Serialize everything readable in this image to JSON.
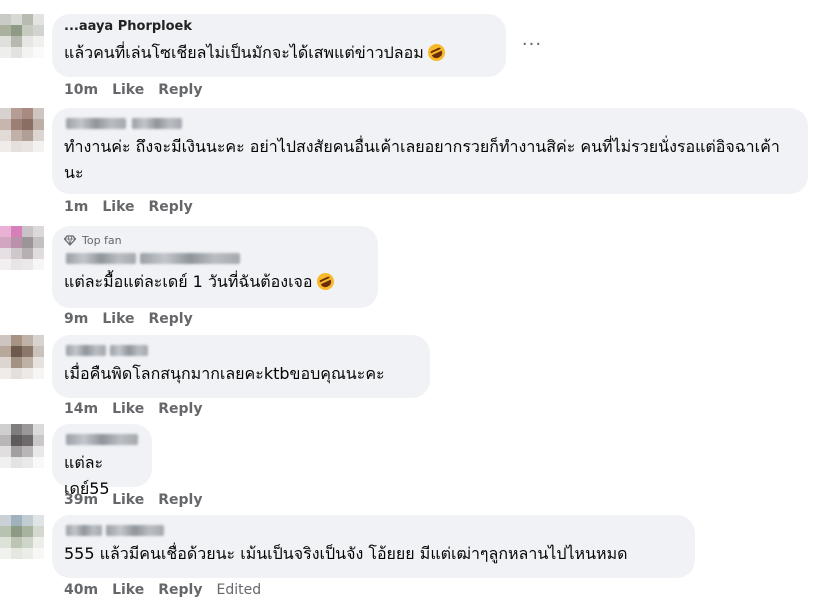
{
  "comments": [
    {
      "name": "...aaya Phorploek",
      "text": "แล้วคนที่เล่นโซเชียลไม่เป็นมักจะได้เสพแต่ข่าวปลอม",
      "emoji": "rolling-on-floor-laughing",
      "time": "10m",
      "like": "Like",
      "reply": "Reply"
    },
    {
      "name": "",
      "text": "ทำงานค่ะ ถึงจะมีเงินนะคะ อย่าไปสงสัยคนอื่นเค้าเลยอยากรวยก็ทำงานสิค่ะ คนที่ไม่รวยนั่งรอแต่อิจฉาเค้านะ",
      "time": "1m",
      "like": "Like",
      "reply": "Reply"
    },
    {
      "badge": "Top fan",
      "name": "",
      "text": "แต่ละมื้อแต่ละเดย์ 1 วันที่ฉันต้องเจอ",
      "emoji": "rolling-on-floor-laughing",
      "time": "9m",
      "like": "Like",
      "reply": "Reply"
    },
    {
      "name": "",
      "text": "เมื่อคืนพิดโลกสนุกมากเลยคะktbขอบคุณนะคะ",
      "time": "14m",
      "like": "Like",
      "reply": "Reply"
    },
    {
      "name": "",
      "text": "แต่ละเดย์55",
      "time": "39m",
      "like": "Like",
      "reply": "Reply"
    },
    {
      "name": "",
      "text": "555 แล้วมีคนเชื่อด้วยนะ เม้นเป็นจริงเป็นจัง โอ้ยยย มีแต่เฒ่าๆลูกหลานไปไหนหมด",
      "time": "40m",
      "like": "Like",
      "reply": "Reply",
      "edited": "Edited"
    }
  ],
  "more_options_icon": "ellipsis-icon",
  "badge_icon": "diamond-icon",
  "colors": {
    "bubble": "#f0f2f5",
    "meta": "#65676b",
    "text": "#050505"
  }
}
